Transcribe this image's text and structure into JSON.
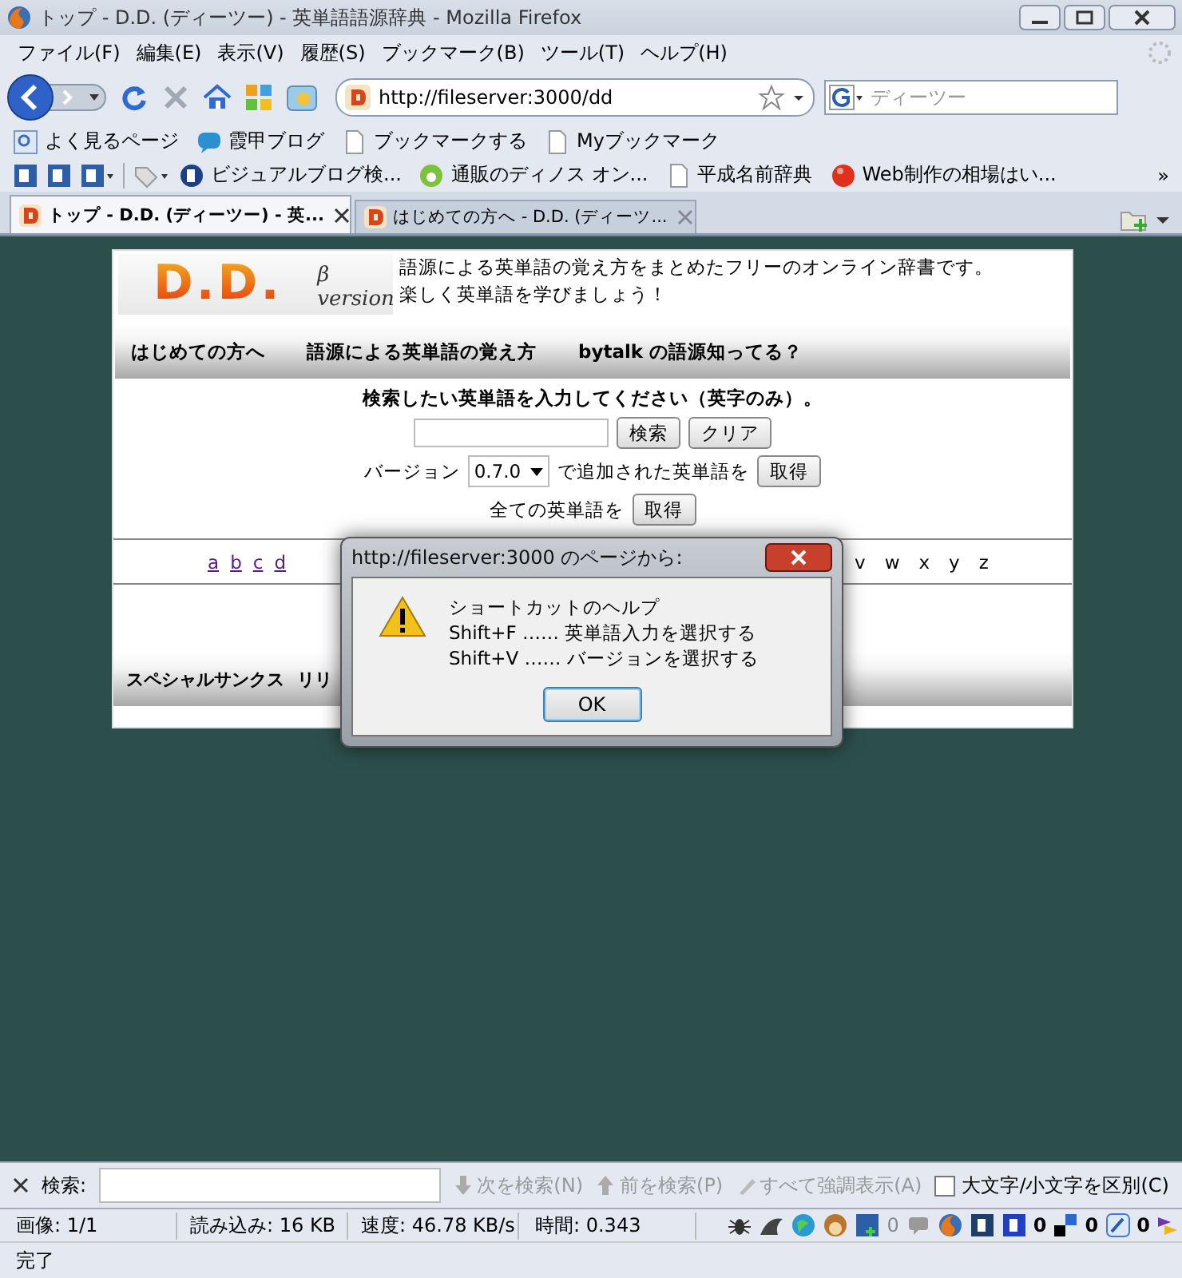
{
  "window": {
    "title": "トップ - D.D. (ディーツー) - 英単語語源辞典 - Mozilla Firefox"
  },
  "menu": [
    "ファイル(F)",
    "編集(E)",
    "表示(V)",
    "履歴(S)",
    "ブックマーク(B)",
    "ツール(T)",
    "ヘルプ(H)"
  ],
  "navigation": {
    "url": "http://fileserver:3000/dd",
    "search_placeholder": "ディーツー"
  },
  "bookmarks": [
    "よく見るページ",
    "霞甲ブログ",
    "ブックマークする",
    "Myブックマーク"
  ],
  "bookmarks_2": {
    "items": [
      "ビジュアルブログ検...",
      "通販のディノス オン...",
      "平成名前辞典",
      "Web制作の相場はい..."
    ],
    "more": "»"
  },
  "tabs": [
    {
      "label": "トップ - D.D. (ディーツー) - 英...",
      "selected": true
    },
    {
      "label": "はじめての方へ - D.D. (ディーツ...",
      "selected": false
    }
  ],
  "page": {
    "logo": "D.D.",
    "logo_version": "β version",
    "tagline": [
      "語源による英単語の覚え方をまとめたフリーのオンライン辞書です。",
      "楽しく英単語を学びましょう！"
    ],
    "nav": [
      "はじめての方へ",
      "語源による英単語の覚え方",
      "bytalk の語源知ってる？"
    ],
    "search_prompt": "検索したい英単語を入力してください（英字のみ）。",
    "search_button": "検索",
    "clear_button": "クリア",
    "version_label": "バージョン",
    "version_value": "0.7.0",
    "version_suffix": "で追加された英単語を",
    "version_get": "取得",
    "all_label": "全ての英単語を",
    "all_get": "取得",
    "letters_left": [
      "a",
      "b",
      "c",
      "d"
    ],
    "letters_right": [
      "v",
      "w",
      "x",
      "y",
      "z"
    ],
    "footer_nav": [
      "スペシャルサンクス",
      "リリ"
    ]
  },
  "dialog": {
    "title": "http://fileserver:3000 のページから:",
    "lines": [
      "ショートカットのヘルプ",
      "Shift+F …… 英単語入力を選択する",
      "Shift+V …… バージョンを選択する"
    ],
    "ok": "OK"
  },
  "find_bar": {
    "label": "検索:",
    "next": "次を検索(N)",
    "previous": "前を検索(P)",
    "highlight": "すべて強調表示(A)",
    "match_case": {
      "label": "大文字/小文字を区別(C)",
      "checked": false
    }
  },
  "status_bar": {
    "panels": [
      "画像: 1/1",
      "読み込み: 16 KB",
      "速度: 46.78 KB/s",
      "時間: 0.343"
    ],
    "counts": [
      "0",
      "0",
      "0",
      "0"
    ],
    "message": "完了"
  }
}
